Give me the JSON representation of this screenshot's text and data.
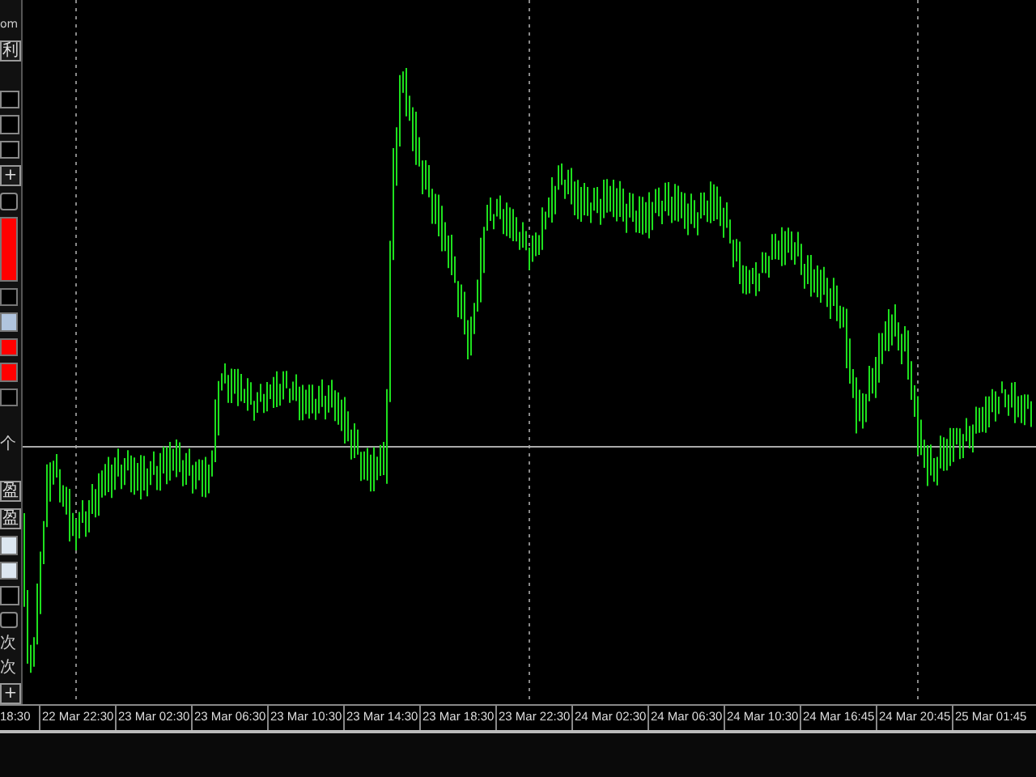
{
  "side_panel": {
    "items": [
      {
        "kind": "text",
        "label": "om"
      },
      {
        "kind": "button",
        "label": "利"
      },
      {
        "kind": "gap"
      },
      {
        "kind": "spinner"
      },
      {
        "kind": "spinner"
      },
      {
        "kind": "spinner"
      },
      {
        "kind": "button",
        "label": "+"
      },
      {
        "kind": "box"
      },
      {
        "kind": "block",
        "color": "#ff0000"
      },
      {
        "kind": "swatch",
        "color": "#000000"
      },
      {
        "kind": "swatch",
        "color": "#b0c4de"
      },
      {
        "kind": "swatch",
        "color": "#ff0000"
      },
      {
        "kind": "swatch",
        "color": "#ff0000"
      },
      {
        "kind": "swatch",
        "color": "#000000"
      },
      {
        "kind": "gap"
      },
      {
        "kind": "text",
        "label": "个"
      },
      {
        "kind": "gap"
      },
      {
        "kind": "button",
        "label": "盈"
      },
      {
        "kind": "button",
        "label": "盈"
      },
      {
        "kind": "swatch",
        "color": "#dce6f0"
      },
      {
        "kind": "swatch",
        "color": "#dce6f0"
      },
      {
        "kind": "spinner"
      },
      {
        "kind": "box"
      },
      {
        "kind": "text",
        "label": "次"
      },
      {
        "kind": "text",
        "label": "次"
      },
      {
        "kind": "button",
        "label": "+"
      }
    ]
  },
  "x_axis": {
    "labels": [
      "18:30",
      "22 Mar 22:30",
      "23 Mar 02:30",
      "23 Mar 06:30",
      "23 Mar 10:30",
      "23 Mar 14:30",
      "23 Mar 18:30",
      "23 Mar 22:30",
      "24 Mar 02:30",
      "24 Mar 06:30",
      "24 Mar 10:30",
      "24 Mar 16:45",
      "24 Mar 20:45",
      "25 Mar 01:45"
    ]
  }
}
